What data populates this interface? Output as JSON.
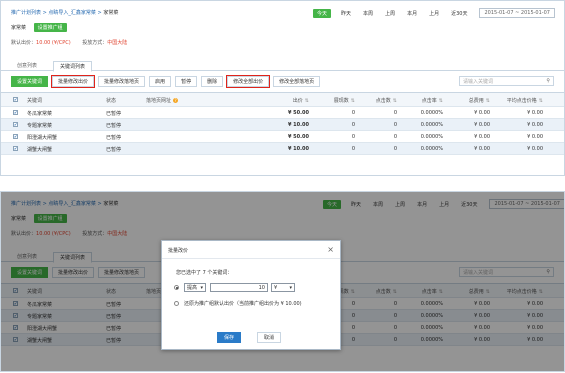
{
  "breadcrumb": {
    "root": "推广计划列表",
    "sep": ">",
    "mid": "点睛导入_汇鑫家常菜",
    "current": "家常菜"
  },
  "group": {
    "name": "家常菜",
    "badge": "设置推广组"
  },
  "info": {
    "bid_label": "默认出价：",
    "bid_value": "10.00 (¥/CPC)",
    "mode_label": "投放方式：",
    "mode_value": "中国大陆"
  },
  "ranges": [
    "今天",
    "昨天",
    "本周",
    "上周",
    "本月",
    "上月",
    "近30天"
  ],
  "active_range": "今天",
  "date_range": "2015-01-07 ~ 2015-01-07",
  "tabs": [
    {
      "label": "创意列表"
    },
    {
      "label": "关键词列表"
    }
  ],
  "toolbar": {
    "buttons": [
      {
        "label": "设置关键词",
        "green": true,
        "hl": false
      },
      {
        "label": "批量修改出价",
        "green": false,
        "hl": true
      },
      {
        "label": "批量修改落地页",
        "green": false,
        "hl": false
      },
      {
        "label": "启用",
        "green": false,
        "hl": false
      },
      {
        "label": "暂停",
        "green": false,
        "hl": false
      },
      {
        "label": "删除",
        "green": false,
        "hl": false
      },
      {
        "label": "修改全部出价",
        "green": false,
        "hl": true
      },
      {
        "label": "修改全部落地页",
        "green": false,
        "hl": false
      }
    ],
    "search_placeholder": "请输入关键词"
  },
  "toolbar2": {
    "buttons": [
      "设置关键词",
      "批量修改出价",
      "批量修改落地页"
    ],
    "search_placeholder": "请输入关键词"
  },
  "table": {
    "headers": [
      "关键词",
      "状态",
      "落地页网址",
      "出价",
      "展现数",
      "点击数",
      "点击率",
      "总费用",
      "平均点击价格"
    ],
    "rows": [
      {
        "kw": "冬瓜家常菜",
        "status": "已暂停",
        "url": "",
        "bid": "¥ 50.00",
        "imp": "0",
        "clk": "0",
        "ctr": "0.0000%",
        "cost": "¥ 0.00",
        "cpc": "¥ 0.00"
      },
      {
        "kw": "专题家常菜",
        "status": "已暂停",
        "url": "",
        "bid": "¥ 10.00",
        "imp": "0",
        "clk": "0",
        "ctr": "0.0000%",
        "cost": "¥ 0.00",
        "cpc": "¥ 0.00"
      },
      {
        "kw": "阳澄湖大闸蟹",
        "status": "已暂停",
        "url": "",
        "bid": "¥ 50.00",
        "imp": "0",
        "clk": "0",
        "ctr": "0.0000%",
        "cost": "¥ 0.00",
        "cpc": "¥ 0.00"
      },
      {
        "kw": "湖蟹大闸蟹",
        "status": "已暂停",
        "url": "",
        "bid": "¥ 10.00",
        "imp": "0",
        "clk": "0",
        "ctr": "0.0000%",
        "cost": "¥ 0.00",
        "cpc": "¥ 0.00"
      }
    ]
  },
  "dialog": {
    "title": "批量改价",
    "close": "×",
    "message": "您已选中了 7 个关键词：",
    "mode": "提高",
    "value": "10",
    "unit": "¥",
    "option2": "还原为推广组默认出价（当前推广组出价为 ¥ 10.00)",
    "save": "保存",
    "cancel": "取消"
  },
  "icons": {
    "help": "?",
    "search": "search-icon",
    "sort": "sort-icon",
    "close": "close-icon"
  },
  "colors": {
    "accent": "#45b548",
    "link": "#2a6db2",
    "highlight": "#e0241b",
    "save": "#2a7bc8"
  }
}
